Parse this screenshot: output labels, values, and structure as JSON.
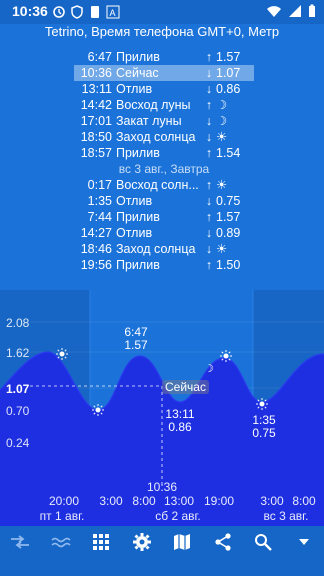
{
  "status_bar": {
    "time": "10:36"
  },
  "header": {
    "title": "Tetrino, Время телефона GMT+0, Метр"
  },
  "table": {
    "rows": [
      {
        "time": "6:47",
        "event": "Прилив",
        "dir": "↑",
        "value": "1.57"
      },
      {
        "time": "10:36",
        "event": "Сейчас",
        "dir": "↓",
        "value": "1.07",
        "highlight": true
      },
      {
        "time": "13:11",
        "event": "Отлив",
        "dir": "↓",
        "value": "0.86"
      },
      {
        "time": "14:42",
        "event": "Восход луны",
        "dir": "↑",
        "value": "☽"
      },
      {
        "time": "17:01",
        "event": "Закат луны",
        "dir": "↓",
        "value": "☽"
      },
      {
        "time": "18:50",
        "event": "Заход солнца",
        "dir": "↓",
        "value": "☀"
      },
      {
        "time": "18:57",
        "event": "Прилив",
        "dir": "↑",
        "value": "1.54"
      }
    ],
    "day_separator": "вс 3 авг., Завтра",
    "rows_next": [
      {
        "time": "0:17",
        "event": "Восход солн...",
        "dir": "↑",
        "value": "☀"
      },
      {
        "time": "1:35",
        "event": "Отлив",
        "dir": "↓",
        "value": "0.75"
      },
      {
        "time": "7:44",
        "event": "Прилив",
        "dir": "↑",
        "value": "1.57"
      },
      {
        "time": "14:27",
        "event": "Отлив",
        "dir": "↓",
        "value": "0.89"
      },
      {
        "time": "18:46",
        "event": "Заход солнца",
        "dir": "↓",
        "value": "☀"
      },
      {
        "time": "19:56",
        "event": "Прилив",
        "dir": "↑",
        "value": "1.50"
      }
    ]
  },
  "chart": {
    "y_ticks": [
      "2.08",
      "1.62",
      "1.07",
      "0.70",
      "0.24"
    ],
    "x_labels": [
      {
        "time": "20:00",
        "day": "пт 1 авг."
      },
      {
        "time": "3:00",
        "day": ""
      },
      {
        "time": "8:00",
        "day": ""
      },
      {
        "time": "13:00",
        "day": "сб 2 авг."
      },
      {
        "time": "19:00",
        "day": ""
      },
      {
        "time": "3:00",
        "day": ""
      },
      {
        "time": "8:00",
        "day": "вс 3 авг."
      }
    ],
    "peak_label": {
      "time": "6:47",
      "value": "1.57"
    },
    "low_label": {
      "time": "13:11",
      "value": "0.86"
    },
    "low2_label": {
      "time": "1:35",
      "value": "0.75"
    },
    "now_label": "Сейчас",
    "now_time": "10:36",
    "colors": {
      "wave": "#1d2fe0",
      "wave_dark": "#1a24b8",
      "bg": "#1b73d9",
      "night": "#1765c4"
    }
  },
  "toolbar": {
    "icons": [
      "swap-icon",
      "tide-icon",
      "grid-icon",
      "gear-icon",
      "map-icon",
      "share-icon",
      "search-icon",
      "dropdown-icon"
    ]
  }
}
